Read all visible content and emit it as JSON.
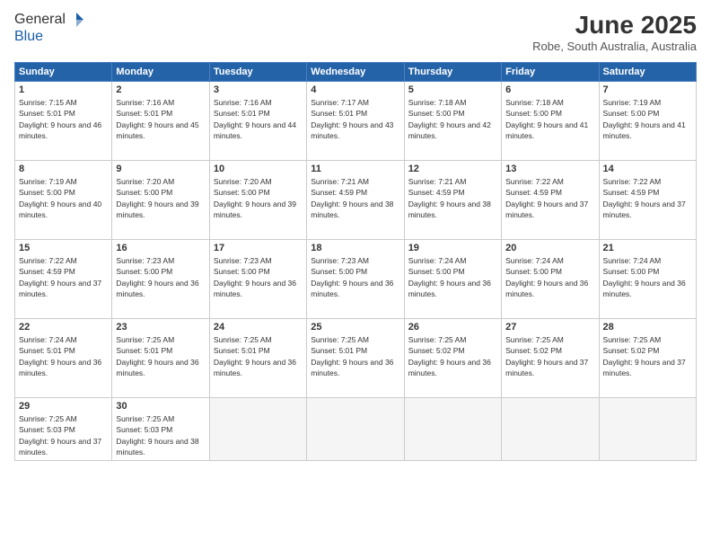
{
  "header": {
    "logo_general": "General",
    "logo_blue": "Blue",
    "month_title": "June 2025",
    "location": "Robe, South Australia, Australia"
  },
  "days_of_week": [
    "Sunday",
    "Monday",
    "Tuesday",
    "Wednesday",
    "Thursday",
    "Friday",
    "Saturday"
  ],
  "weeks": [
    [
      {
        "num": "1",
        "sunrise": "Sunrise: 7:15 AM",
        "sunset": "Sunset: 5:01 PM",
        "daylight": "Daylight: 9 hours and 46 minutes."
      },
      {
        "num": "2",
        "sunrise": "Sunrise: 7:16 AM",
        "sunset": "Sunset: 5:01 PM",
        "daylight": "Daylight: 9 hours and 45 minutes."
      },
      {
        "num": "3",
        "sunrise": "Sunrise: 7:16 AM",
        "sunset": "Sunset: 5:01 PM",
        "daylight": "Daylight: 9 hours and 44 minutes."
      },
      {
        "num": "4",
        "sunrise": "Sunrise: 7:17 AM",
        "sunset": "Sunset: 5:01 PM",
        "daylight": "Daylight: 9 hours and 43 minutes."
      },
      {
        "num": "5",
        "sunrise": "Sunrise: 7:18 AM",
        "sunset": "Sunset: 5:00 PM",
        "daylight": "Daylight: 9 hours and 42 minutes."
      },
      {
        "num": "6",
        "sunrise": "Sunrise: 7:18 AM",
        "sunset": "Sunset: 5:00 PM",
        "daylight": "Daylight: 9 hours and 41 minutes."
      },
      {
        "num": "7",
        "sunrise": "Sunrise: 7:19 AM",
        "sunset": "Sunset: 5:00 PM",
        "daylight": "Daylight: 9 hours and 41 minutes."
      }
    ],
    [
      {
        "num": "8",
        "sunrise": "Sunrise: 7:19 AM",
        "sunset": "Sunset: 5:00 PM",
        "daylight": "Daylight: 9 hours and 40 minutes."
      },
      {
        "num": "9",
        "sunrise": "Sunrise: 7:20 AM",
        "sunset": "Sunset: 5:00 PM",
        "daylight": "Daylight: 9 hours and 39 minutes."
      },
      {
        "num": "10",
        "sunrise": "Sunrise: 7:20 AM",
        "sunset": "Sunset: 5:00 PM",
        "daylight": "Daylight: 9 hours and 39 minutes."
      },
      {
        "num": "11",
        "sunrise": "Sunrise: 7:21 AM",
        "sunset": "Sunset: 4:59 PM",
        "daylight": "Daylight: 9 hours and 38 minutes."
      },
      {
        "num": "12",
        "sunrise": "Sunrise: 7:21 AM",
        "sunset": "Sunset: 4:59 PM",
        "daylight": "Daylight: 9 hours and 38 minutes."
      },
      {
        "num": "13",
        "sunrise": "Sunrise: 7:22 AM",
        "sunset": "Sunset: 4:59 PM",
        "daylight": "Daylight: 9 hours and 37 minutes."
      },
      {
        "num": "14",
        "sunrise": "Sunrise: 7:22 AM",
        "sunset": "Sunset: 4:59 PM",
        "daylight": "Daylight: 9 hours and 37 minutes."
      }
    ],
    [
      {
        "num": "15",
        "sunrise": "Sunrise: 7:22 AM",
        "sunset": "Sunset: 4:59 PM",
        "daylight": "Daylight: 9 hours and 37 minutes."
      },
      {
        "num": "16",
        "sunrise": "Sunrise: 7:23 AM",
        "sunset": "Sunset: 5:00 PM",
        "daylight": "Daylight: 9 hours and 36 minutes."
      },
      {
        "num": "17",
        "sunrise": "Sunrise: 7:23 AM",
        "sunset": "Sunset: 5:00 PM",
        "daylight": "Daylight: 9 hours and 36 minutes."
      },
      {
        "num": "18",
        "sunrise": "Sunrise: 7:23 AM",
        "sunset": "Sunset: 5:00 PM",
        "daylight": "Daylight: 9 hours and 36 minutes."
      },
      {
        "num": "19",
        "sunrise": "Sunrise: 7:24 AM",
        "sunset": "Sunset: 5:00 PM",
        "daylight": "Daylight: 9 hours and 36 minutes."
      },
      {
        "num": "20",
        "sunrise": "Sunrise: 7:24 AM",
        "sunset": "Sunset: 5:00 PM",
        "daylight": "Daylight: 9 hours and 36 minutes."
      },
      {
        "num": "21",
        "sunrise": "Sunrise: 7:24 AM",
        "sunset": "Sunset: 5:00 PM",
        "daylight": "Daylight: 9 hours and 36 minutes."
      }
    ],
    [
      {
        "num": "22",
        "sunrise": "Sunrise: 7:24 AM",
        "sunset": "Sunset: 5:01 PM",
        "daylight": "Daylight: 9 hours and 36 minutes."
      },
      {
        "num": "23",
        "sunrise": "Sunrise: 7:25 AM",
        "sunset": "Sunset: 5:01 PM",
        "daylight": "Daylight: 9 hours and 36 minutes."
      },
      {
        "num": "24",
        "sunrise": "Sunrise: 7:25 AM",
        "sunset": "Sunset: 5:01 PM",
        "daylight": "Daylight: 9 hours and 36 minutes."
      },
      {
        "num": "25",
        "sunrise": "Sunrise: 7:25 AM",
        "sunset": "Sunset: 5:01 PM",
        "daylight": "Daylight: 9 hours and 36 minutes."
      },
      {
        "num": "26",
        "sunrise": "Sunrise: 7:25 AM",
        "sunset": "Sunset: 5:02 PM",
        "daylight": "Daylight: 9 hours and 36 minutes."
      },
      {
        "num": "27",
        "sunrise": "Sunrise: 7:25 AM",
        "sunset": "Sunset: 5:02 PM",
        "daylight": "Daylight: 9 hours and 37 minutes."
      },
      {
        "num": "28",
        "sunrise": "Sunrise: 7:25 AM",
        "sunset": "Sunset: 5:02 PM",
        "daylight": "Daylight: 9 hours and 37 minutes."
      }
    ],
    [
      {
        "num": "29",
        "sunrise": "Sunrise: 7:25 AM",
        "sunset": "Sunset: 5:03 PM",
        "daylight": "Daylight: 9 hours and 37 minutes."
      },
      {
        "num": "30",
        "sunrise": "Sunrise: 7:25 AM",
        "sunset": "Sunset: 5:03 PM",
        "daylight": "Daylight: 9 hours and 38 minutes."
      },
      null,
      null,
      null,
      null,
      null
    ]
  ]
}
